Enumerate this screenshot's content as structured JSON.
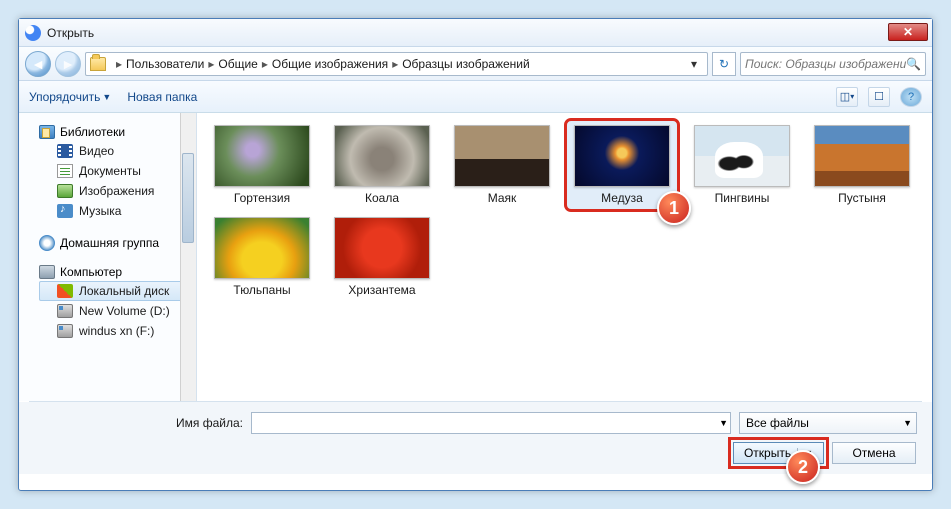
{
  "window": {
    "title": "Открыть"
  },
  "nav": {
    "breadcrumbs": [
      "Пользователи",
      "Общие",
      "Общие изображения",
      "Образцы изображений"
    ],
    "search_placeholder": "Поиск: Образцы изображений"
  },
  "toolbar": {
    "organize": "Упорядочить",
    "new_folder": "Новая папка"
  },
  "sidebar": {
    "libraries": {
      "label": "Библиотеки",
      "items": [
        {
          "label": "Видео",
          "icon": "video"
        },
        {
          "label": "Документы",
          "icon": "doc"
        },
        {
          "label": "Изображения",
          "icon": "img"
        },
        {
          "label": "Музыка",
          "icon": "music"
        }
      ]
    },
    "homegroup": {
      "label": "Домашняя группа"
    },
    "computer": {
      "label": "Компьютер",
      "drives": [
        {
          "label": "Локальный диск",
          "icon": "win",
          "selected": true
        },
        {
          "label": "New Volume (D:)",
          "icon": "hdd"
        },
        {
          "label": "windus xn (F:)",
          "icon": "hdd"
        }
      ]
    }
  },
  "files": [
    {
      "label": "Гортензия"
    },
    {
      "label": "Коала"
    },
    {
      "label": "Маяк"
    },
    {
      "label": "Медуза",
      "selected": true
    },
    {
      "label": "Пингвины"
    },
    {
      "label": "Пустыня"
    },
    {
      "label": "Тюльпаны"
    },
    {
      "label": "Хризантема"
    }
  ],
  "footer": {
    "filename_label": "Имя файла:",
    "filename_value": "",
    "filter": "Все файлы",
    "open": "Открыть",
    "cancel": "Отмена"
  },
  "callouts": {
    "c1": "1",
    "c2": "2"
  }
}
